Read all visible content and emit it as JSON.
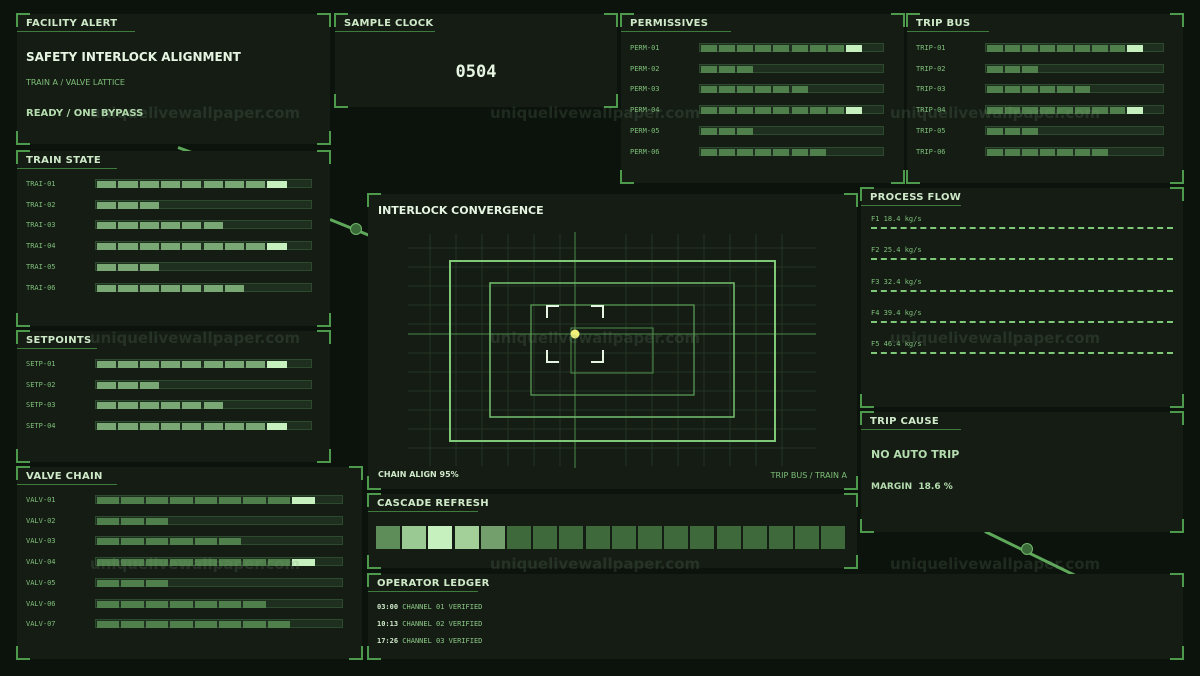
{
  "facility_alert": {
    "title": "FACILITY ALERT",
    "headline": "SAFETY INTERLOCK ALIGNMENT",
    "subline": "TRAIN A / VALVE LATTICE",
    "status": "READY / ONE BYPASS"
  },
  "sample_clock": {
    "title": "SAMPLE CLOCK",
    "value": "0504"
  },
  "permissives": {
    "title": "PERMISSIVES",
    "rows": [
      {
        "label": "PERM-01",
        "filled": 9,
        "highlight": 8
      },
      {
        "label": "PERM-02",
        "filled": 3,
        "highlight": -1
      },
      {
        "label": "PERM-03",
        "filled": 6,
        "highlight": -1
      },
      {
        "label": "PERM-04",
        "filled": 9,
        "highlight": 8
      },
      {
        "label": "PERM-05",
        "filled": 3,
        "highlight": -1
      },
      {
        "label": "PERM-06",
        "filled": 7,
        "highlight": -1
      }
    ]
  },
  "trip_bus": {
    "title": "TRIP BUS",
    "rows": [
      {
        "label": "TRIP-01",
        "filled": 9,
        "highlight": 8
      },
      {
        "label": "TRIP-02",
        "filled": 3,
        "highlight": -1
      },
      {
        "label": "TRIP-03",
        "filled": 6,
        "highlight": -1
      },
      {
        "label": "TRIP-04",
        "filled": 9,
        "highlight": 8
      },
      {
        "label": "TRIP-05",
        "filled": 3,
        "highlight": -1
      },
      {
        "label": "TRIP-06",
        "filled": 7,
        "highlight": -1
      }
    ]
  },
  "train_state": {
    "title": "TRAIN STATE",
    "rows": [
      {
        "label": "TRAI-01",
        "filled": 9,
        "highlight": 8
      },
      {
        "label": "TRAI-02",
        "filled": 3,
        "highlight": -1
      },
      {
        "label": "TRAI-03",
        "filled": 6,
        "highlight": -1
      },
      {
        "label": "TRAI-04",
        "filled": 9,
        "highlight": 8
      },
      {
        "label": "TRAI-05",
        "filled": 3,
        "highlight": -1
      },
      {
        "label": "TRAI-06",
        "filled": 7,
        "highlight": -1
      }
    ]
  },
  "setpoints": {
    "title": "SETPOINTS",
    "rows": [
      {
        "label": "SETP-01",
        "filled": 9,
        "highlight": 8
      },
      {
        "label": "SETP-02",
        "filled": 3,
        "highlight": -1
      },
      {
        "label": "SETP-03",
        "filled": 6,
        "highlight": -1
      },
      {
        "label": "SETP-04",
        "filled": 9,
        "highlight": 8
      }
    ]
  },
  "valve_chain": {
    "title": "VALVE CHAIN",
    "rows": [
      {
        "label": "VALV-01",
        "filled": 9,
        "highlight": 8
      },
      {
        "label": "VALV-02",
        "filled": 3,
        "highlight": -1
      },
      {
        "label": "VALV-03",
        "filled": 6,
        "highlight": -1
      },
      {
        "label": "VALV-04",
        "filled": 9,
        "highlight": 8
      },
      {
        "label": "VALV-05",
        "filled": 3,
        "highlight": -1
      },
      {
        "label": "VALV-06",
        "filled": 7,
        "highlight": -1
      },
      {
        "label": "VALV-07",
        "filled": 8,
        "highlight": -1
      }
    ]
  },
  "interlock": {
    "title": "INTERLOCK CONVERGENCE",
    "left_label": "CHAIN ALIGN 95%",
    "right_label": "TRIP BUS / TRAIN A"
  },
  "process_flow": {
    "title": "PROCESS FLOW",
    "flows": [
      {
        "label": "F1 18.4 kg/s"
      },
      {
        "label": "F2 25.4 kg/s"
      },
      {
        "label": "F3 32.4 kg/s"
      },
      {
        "label": "F4 39.4 kg/s"
      },
      {
        "label": "F5 46.4 kg/s"
      }
    ]
  },
  "trip_cause": {
    "title": "TRIP CAUSE",
    "status": "NO AUTO TRIP",
    "margin": "MARGIN  18.6 %"
  },
  "cascade_refresh": {
    "title": "CASCADE REFRESH",
    "cells": [
      "#5f8d59",
      "#9bc993",
      "#c7f0bf",
      "#a3cf99",
      "#739f6c",
      "#3e6a3b",
      "#3e6a3b",
      "#3e6a3b",
      "#3e6a3b",
      "#3e6a3b",
      "#3e6a3b",
      "#3e6a3b",
      "#3e6a3b",
      "#3e6a3b",
      "#3e6a3b",
      "#3e6a3b",
      "#3e6a3b",
      "#3e6a3b"
    ]
  },
  "operator_ledger": {
    "title": "OPERATOR LEDGER",
    "entries": [
      {
        "time": "03:00",
        "text": "CHANNEL 01 VERIFIED"
      },
      {
        "time": "10:13",
        "text": "CHANNEL 02 VERIFIED"
      },
      {
        "time": "17:26",
        "text": "CHANNEL 03 VERIFIED"
      }
    ]
  },
  "watermark": "uniquelivewallpaper.com",
  "colors": {
    "accent": "#7ec878",
    "segment": "#4f7f4a",
    "segment_hi": "#c6f0bd",
    "track": "#1f2f1f"
  }
}
